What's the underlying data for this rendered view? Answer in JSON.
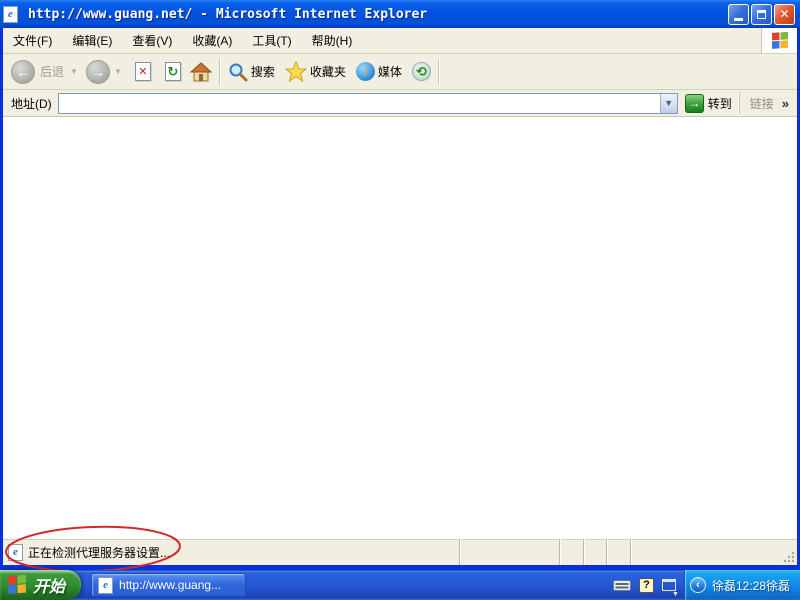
{
  "window": {
    "title": "http://www.guang.net/ - Microsoft Internet Explorer"
  },
  "menu": {
    "items": [
      "文件(F)",
      "编辑(E)",
      "查看(V)",
      "收藏(A)",
      "工具(T)",
      "帮助(H)"
    ]
  },
  "toolbar": {
    "back_label": "后退",
    "search_label": "搜索",
    "favorites_label": "收藏夹",
    "media_label": "媒体"
  },
  "addressbar": {
    "label": "地址(D)",
    "value": "",
    "go_label": "转到",
    "links_label": "链接",
    "links_chevron": "»"
  },
  "statusbar": {
    "text": "正在检测代理服务器设置..."
  },
  "taskbar": {
    "start_label": "开始",
    "task_label": "http://www.guang...",
    "tray_time": "徐磊12:28徐磊"
  },
  "icons": {
    "ie_glyph": "e",
    "back_arrow": "←",
    "forward_arrow": "→",
    "dropdown_caret": "▼",
    "stop_glyph": "✕",
    "refresh_glyph": "↻",
    "music_note": "♪",
    "history_glyph": "⟲",
    "combo_caret": "▼",
    "go_arrow": "→",
    "tray_chevron": "‹",
    "help_glyph": "?",
    "close_glyph": "✕",
    "restore_caret": "▼"
  },
  "colors": {
    "titlebar_blue": "#0353e0",
    "annotation_red": "#d22a2a",
    "start_green": "#2f8b2f",
    "tray_blue": "#1187e6"
  }
}
